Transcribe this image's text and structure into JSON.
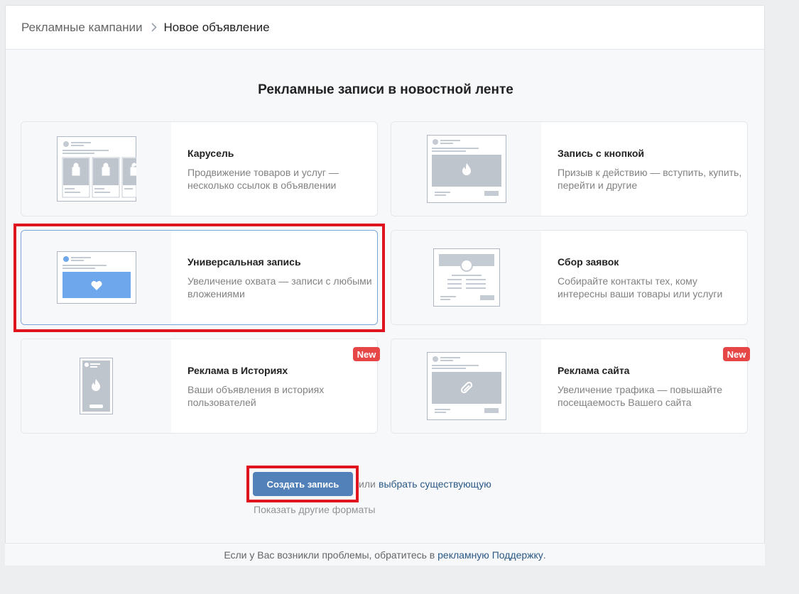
{
  "breadcrumb": {
    "parent": "Рекламные кампании",
    "current": "Новое объявление"
  },
  "section_title": "Рекламные записи в новостной ленте",
  "cards": [
    {
      "title": "Карусель",
      "description": "Продвижение товаров и услуг — несколько ссылок в объявлении",
      "icon": "carousel-icon"
    },
    {
      "title": "Запись с кнопкой",
      "description": "Призыв к действию — вступить, купить, перейти и другие",
      "icon": "button-post-icon"
    },
    {
      "title": "Универсальная запись",
      "description": "Увеличение охвата — записи с любыми вложениями",
      "icon": "universal-post-icon",
      "selected": true
    },
    {
      "title": "Сбор заявок",
      "description": "Собирайте контакты тех, кому интересны ваши товары или услуги",
      "icon": "lead-form-icon"
    },
    {
      "title": "Реклама в Историях",
      "description": "Ваши объявления в историях пользователей",
      "icon": "stories-icon",
      "badge": "New"
    },
    {
      "title": "Реклама сайта",
      "description": "Увеличение трафика — повышайте посещаемость Вашего сайта",
      "icon": "website-ad-icon",
      "badge": "New"
    }
  ],
  "actions": {
    "create_label": "Создать запись",
    "or_text": "или",
    "choose_existing": "выбрать существующую",
    "more_formats": "Показать другие форматы"
  },
  "footer": {
    "text": "Если у Вас возникли проблемы, обратитесь в",
    "link": "рекламную Поддержку",
    "suffix": "."
  },
  "colors": {
    "accent": "#5181b8",
    "link": "#2a5885",
    "badge": "#e64646",
    "highlight": "#e0141e",
    "selected_preview": "#6fa7ec"
  }
}
